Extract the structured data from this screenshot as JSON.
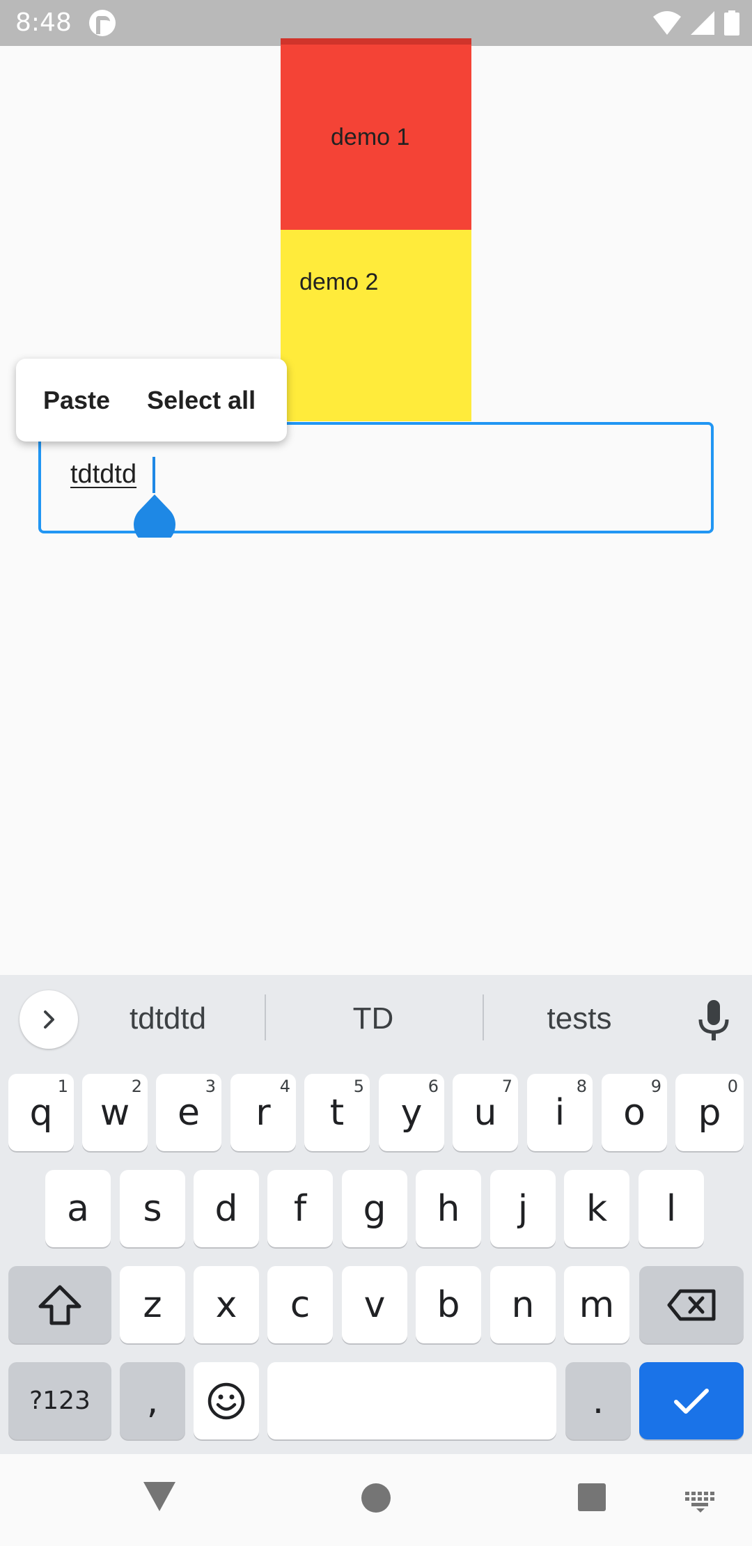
{
  "status_bar": {
    "time": "8:48"
  },
  "demo": {
    "box1": "demo 1",
    "box2": "demo 2"
  },
  "context_menu": {
    "paste": "Paste",
    "select_all": "Select all"
  },
  "text_field": {
    "value": "tdtdtd"
  },
  "keyboard": {
    "suggestions": [
      "tdtdtd",
      "TD",
      "tests"
    ],
    "row1": [
      {
        "k": "q",
        "h": "1"
      },
      {
        "k": "w",
        "h": "2"
      },
      {
        "k": "e",
        "h": "3"
      },
      {
        "k": "r",
        "h": "4"
      },
      {
        "k": "t",
        "h": "5"
      },
      {
        "k": "y",
        "h": "6"
      },
      {
        "k": "u",
        "h": "7"
      },
      {
        "k": "i",
        "h": "8"
      },
      {
        "k": "o",
        "h": "9"
      },
      {
        "k": "p",
        "h": "0"
      }
    ],
    "row2": [
      "a",
      "s",
      "d",
      "f",
      "g",
      "h",
      "j",
      "k",
      "l"
    ],
    "row3": [
      "z",
      "x",
      "c",
      "v",
      "b",
      "n",
      "m"
    ],
    "symbols_label": "?123",
    "comma": ",",
    "period": "."
  },
  "colors": {
    "accent": "#2196f3",
    "demo1": "#f44336",
    "demo2": "#ffeb3b",
    "enter_key": "#1a73e8"
  }
}
